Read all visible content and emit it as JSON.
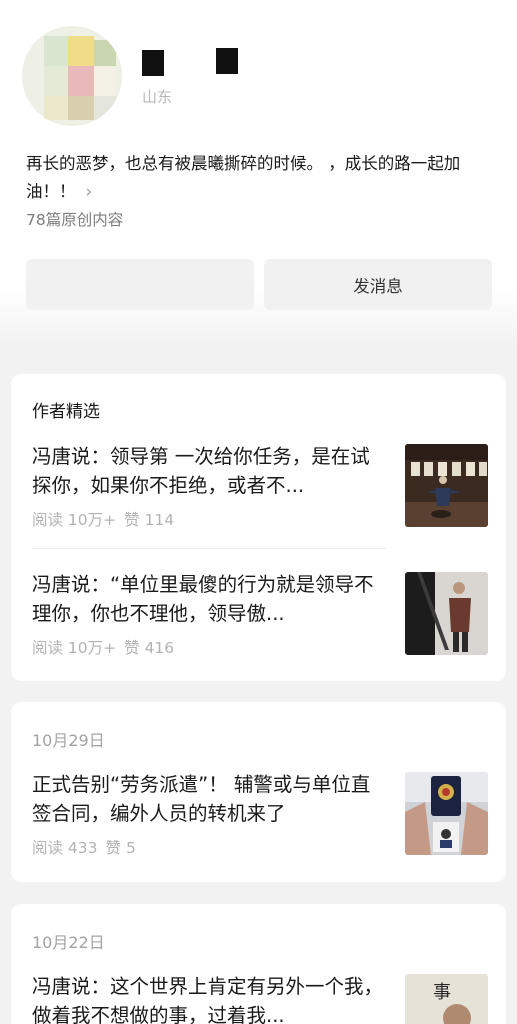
{
  "profile": {
    "location": "山东",
    "bio": "再长的恶梦，也总有被晨曦撕碎的时候。 ，成长的路一起加油！！",
    "bio_chevron": "›",
    "original_count": "78篇原创内容",
    "follow_label": "",
    "message_label": "发消息"
  },
  "featured": {
    "heading": "作者精选",
    "articles": [
      {
        "title": "冯唐说：领导第 一次给你任务，是在试探你，如果你不拒绝，或者不...",
        "reads": "阅读 10万+",
        "likes": "赞 114"
      },
      {
        "title": "冯唐说：“单位里最傻的行为就是领导不理你，你也不理他，领导傲...",
        "reads": "阅读 10万+",
        "likes": "赞 416"
      }
    ]
  },
  "history": [
    {
      "date": "10月29日",
      "title": "正式告别“劳务派遣”！ 辅警或与单位直签合同，编外人员的转机来了",
      "reads": "阅读 433",
      "likes": "赞 5"
    },
    {
      "date": "10月22日",
      "title": "冯唐说：这个世界上肯定有另外一个我，做着我不想做的事，过着我...",
      "reads": "",
      "likes": ""
    }
  ],
  "colors": {
    "background": "#f2f2f2",
    "card": "#ffffff",
    "meta_text": "#b3b3b3",
    "button_bg": "#f1f1f1"
  }
}
